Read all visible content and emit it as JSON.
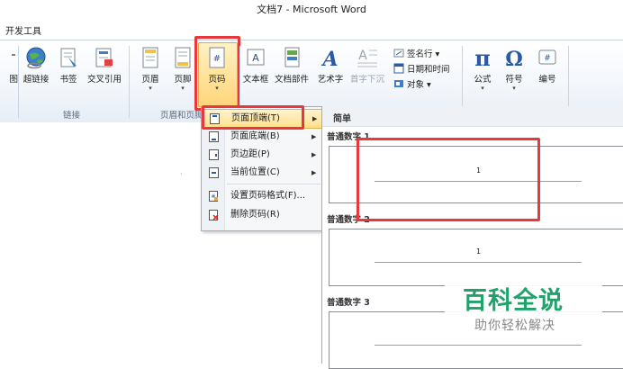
{
  "window": {
    "title": "文档7 - Microsoft Word"
  },
  "tabs": {
    "developer": "开发工具"
  },
  "ribbon": {
    "partial_left_label": "图",
    "buttons": {
      "hyperlink": "超链接",
      "bookmark": "书签",
      "crossref": "交叉引用",
      "header": "页眉",
      "footer": "页脚",
      "pagenum": "页码",
      "textbox": "文本框",
      "quickparts": "文档部件",
      "wordart": "艺术字",
      "dropcap": "首字下沉",
      "equation": "公式",
      "symbol": "符号",
      "number": "编号"
    },
    "small_items": {
      "signature": "签名行",
      "datetime": "日期和时间",
      "object": "对象"
    },
    "groups": {
      "links": "链接",
      "header_footer": "页眉和页脚"
    }
  },
  "menu": {
    "items": [
      {
        "label": "页面顶端(T)",
        "arrow": "▶"
      },
      {
        "label": "页面底端(B)",
        "arrow": "▶"
      },
      {
        "label": "页边距(P)",
        "arrow": "▶"
      },
      {
        "label": "当前位置(C)",
        "arrow": "▶"
      },
      {
        "label": "设置页码格式(F)...",
        "arrow": ""
      },
      {
        "label": "删除页码(R)",
        "arrow": ""
      }
    ]
  },
  "gallery": {
    "header": "简单",
    "items": [
      {
        "label": "普通数字 1",
        "num": "1"
      },
      {
        "label": "普通数字 2",
        "num": "1"
      },
      {
        "label": "普通数字 3",
        "num": ""
      }
    ]
  },
  "watermark": {
    "title": "百科全说",
    "subtitle": "助你轻松解决"
  },
  "colors": {
    "highlight_red": "#e8383d",
    "watermark_green": "#1fa36a",
    "active_item": "#ffdf8a"
  }
}
